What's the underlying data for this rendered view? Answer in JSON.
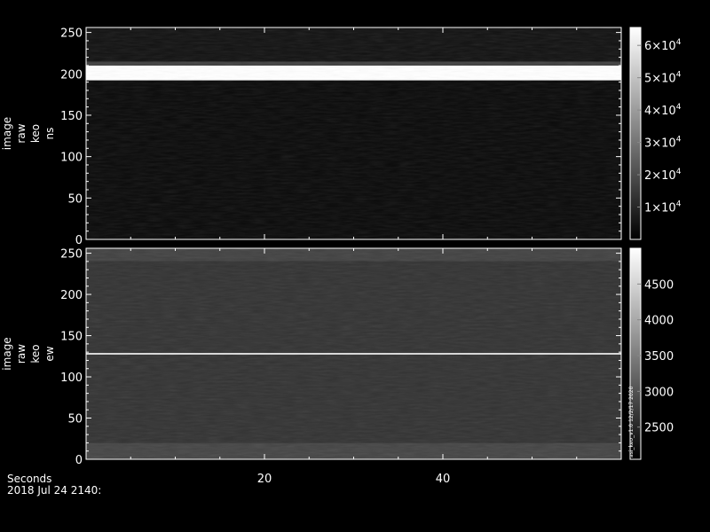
{
  "footer": {
    "xaxis_title": "Seconds",
    "date_label": "2018 Jul 24 2140:"
  },
  "chart_data": [
    {
      "type": "heatmap",
      "ylabel_lines": [
        "image",
        "raw",
        "keo",
        "ns"
      ],
      "ylim": [
        0,
        256
      ],
      "yticks": [
        0,
        50,
        100,
        150,
        200,
        250
      ],
      "xlim": [
        0,
        60
      ],
      "xticks": [
        20,
        40
      ],
      "colorbar": {
        "range": [
          0,
          65535
        ],
        "ticks": [
          10000,
          20000,
          30000,
          40000,
          50000,
          60000
        ],
        "tick_mantissas": [
          "1",
          "2",
          "3",
          "4",
          "5",
          "6"
        ],
        "tick_base": "×10",
        "tick_exponent": "4"
      },
      "features": [
        {
          "kind": "band",
          "y_from": 192,
          "y_to": 210,
          "intensity": 1.0
        },
        {
          "kind": "band",
          "y_from": 210,
          "y_to": 215,
          "intensity": 0.25
        },
        {
          "kind": "band",
          "y_from": 215,
          "y_to": 256,
          "intensity": 0.07
        },
        {
          "kind": "band",
          "y_from": 0,
          "y_to": 192,
          "intensity": 0.04
        }
      ]
    },
    {
      "type": "heatmap",
      "ylabel_lines": [
        "image",
        "raw",
        "keo",
        "ew"
      ],
      "ylim": [
        0,
        256
      ],
      "yticks": [
        0,
        50,
        100,
        150,
        200,
        250
      ],
      "xlim": [
        0,
        60
      ],
      "xticks": [
        20,
        40
      ],
      "colorbar": {
        "range": [
          2050,
          5000
        ],
        "ticks": [
          2500,
          3000,
          3500,
          4000,
          4500
        ],
        "tick_labels": [
          "2500",
          "3000",
          "3500",
          "4000",
          "4500"
        ]
      },
      "side_annotation": "asi_keo_v1.0 12/2/17 2020",
      "features": [
        {
          "kind": "line",
          "y": 128,
          "intensity": 0.85
        },
        {
          "kind": "band",
          "y_from": 0,
          "y_to": 20,
          "intensity": 0.27
        },
        {
          "kind": "band",
          "y_from": 20,
          "y_to": 240,
          "intensity": 0.2
        },
        {
          "kind": "band",
          "y_from": 240,
          "y_to": 256,
          "intensity": 0.26
        }
      ]
    }
  ]
}
